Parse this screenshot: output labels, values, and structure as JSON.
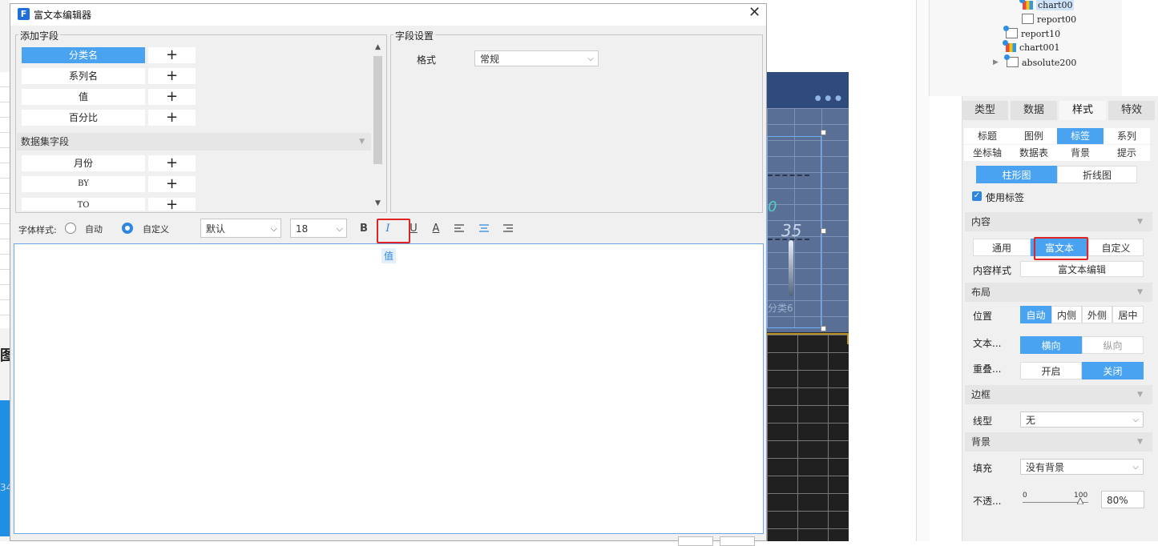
{
  "dialog": {
    "title": "富文本编辑器",
    "add_fields": {
      "group_title": "添加字段",
      "fields": [
        {
          "label": "分类名",
          "plus": "+"
        },
        {
          "label": "系列名",
          "plus": "+"
        },
        {
          "label": "值",
          "plus": "+"
        },
        {
          "label": "百分比",
          "plus": "+"
        }
      ],
      "dataset_header": "数据集字段",
      "dataset_fields": [
        {
          "label": "月份",
          "plus": "+"
        },
        {
          "label": "BY",
          "plus": "+"
        },
        {
          "label": "TO",
          "plus": "+"
        }
      ]
    },
    "field_settings": {
      "group_title": "字段设置",
      "format_label": "格式",
      "format_value": "常规"
    },
    "toolbar": {
      "font_style_label": "字体样式:",
      "radio_auto": "自动",
      "radio_custom": "自定义",
      "font_family": "默认",
      "font_size": "18",
      "bold_glyph": "B",
      "italic_glyph": "I",
      "underline_glyph": "U",
      "color_glyph": "A"
    },
    "editor_token": "值"
  },
  "tree": {
    "items": [
      "chart00",
      "report00",
      "report10",
      "chart001",
      "absolute200"
    ]
  },
  "panel": {
    "tabs": [
      "类型",
      "数据",
      "样式",
      "特效"
    ],
    "subtabs": [
      "标题",
      "图例",
      "标签",
      "系列",
      "坐标轴",
      "数据表",
      "背景",
      "提示"
    ],
    "chart_types": [
      "柱形图",
      "折线图"
    ],
    "use_label": "使用标签",
    "content_section": "内容",
    "content_modes": [
      "通用",
      "富文本",
      "自定义"
    ],
    "content_style_label": "内容样式",
    "content_style_button": "富文本编辑",
    "layout_section": "布局",
    "position_label": "位置",
    "position_options": [
      "自动",
      "内侧",
      "外侧",
      "居中"
    ],
    "text_dir_label": "文本...",
    "text_dir_options": [
      "横向",
      "纵向"
    ],
    "overlap_label": "重叠...",
    "overlap_options": [
      "开启",
      "关闭"
    ],
    "border_section": "边框",
    "line_type_label": "线型",
    "line_type_value": "无",
    "background_section": "背景",
    "fill_label": "填充",
    "fill_value": "没有背景",
    "opacity_label": "不透...",
    "opacity_min": "0",
    "opacity_max": "100",
    "opacity_value": "80%"
  },
  "canvas": {
    "label_value": "35",
    "label_zero": "0",
    "category": "分类6",
    "left_char": "图",
    "left_num": "34"
  }
}
